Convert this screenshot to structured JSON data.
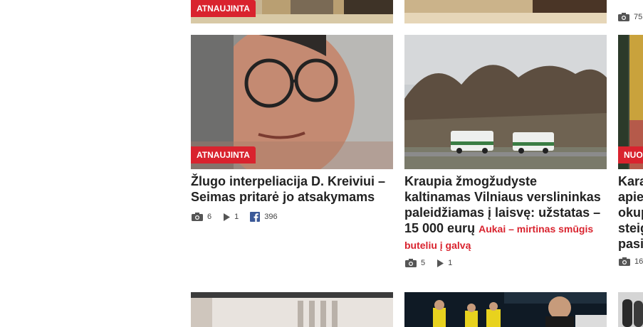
{
  "top_row": {
    "card1_badge": "ATNAUJINTA",
    "card3_photo_count": "75"
  },
  "cards": [
    {
      "badge": "ATNAUJINTA",
      "title": "Žlugo interpeliacija D. Kreiviui – Seimas pritarė jo atsakymams",
      "photos": "6",
      "videos": "1",
      "shares": "396"
    },
    {
      "title": "Kraupia žmogžudyste kaltinamas Vilniaus verslininkas paleidžiamas į laisvę: užstatas – 15 000 eurų",
      "subtitle": "Aukai – mirtinas smūgis buteliu į galvą",
      "photos": "5",
      "videos": "1"
    },
    {
      "badge": "NUO",
      "title_lines": [
        "Kara",
        "apie",
        "okup",
        "steig",
        "pasi"
      ],
      "photos": "16"
    }
  ],
  "colors": {
    "accent": "#d9232e",
    "facebook": "#3b5998"
  }
}
